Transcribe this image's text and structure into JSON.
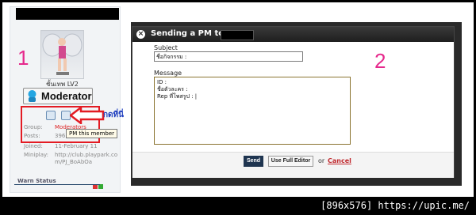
{
  "annotations": {
    "step1": "1",
    "step2": "2",
    "click_here": "กดที่นี่"
  },
  "profile": {
    "rank": "ชั้นเทพ LV2",
    "badge": "Moderator",
    "tooltip": "PM this member",
    "info": [
      {
        "label": "Group:",
        "value": "Moderators"
      },
      {
        "label": "Posts:",
        "value": "396"
      },
      {
        "label": "Joined:",
        "value": "11-February 11"
      },
      {
        "label": "Miniplay:",
        "value": "http://club.playpark.co"
      },
      {
        "label": "",
        "value": "m/PJ_BoAbOa"
      }
    ],
    "warn_status": "Warn Status"
  },
  "dialog": {
    "title": "Sending a PM to PP_",
    "subject_label": "Subject",
    "subject_value": "ชื่อกิจกรรม :",
    "message_label": "Message",
    "message_value": "ID :\nชื่อตัวละคร :\nRep ที่โพสรูป : |",
    "send": "Send",
    "full_editor": "Use Full Editor",
    "or": "or",
    "cancel": "Cancel"
  },
  "watermark": "[896x576] https://upic.me/",
  "colors": {
    "annotation": "#e6298c",
    "highlight": "#e31b23",
    "link": "#d22",
    "send_button": "#1f3550"
  }
}
